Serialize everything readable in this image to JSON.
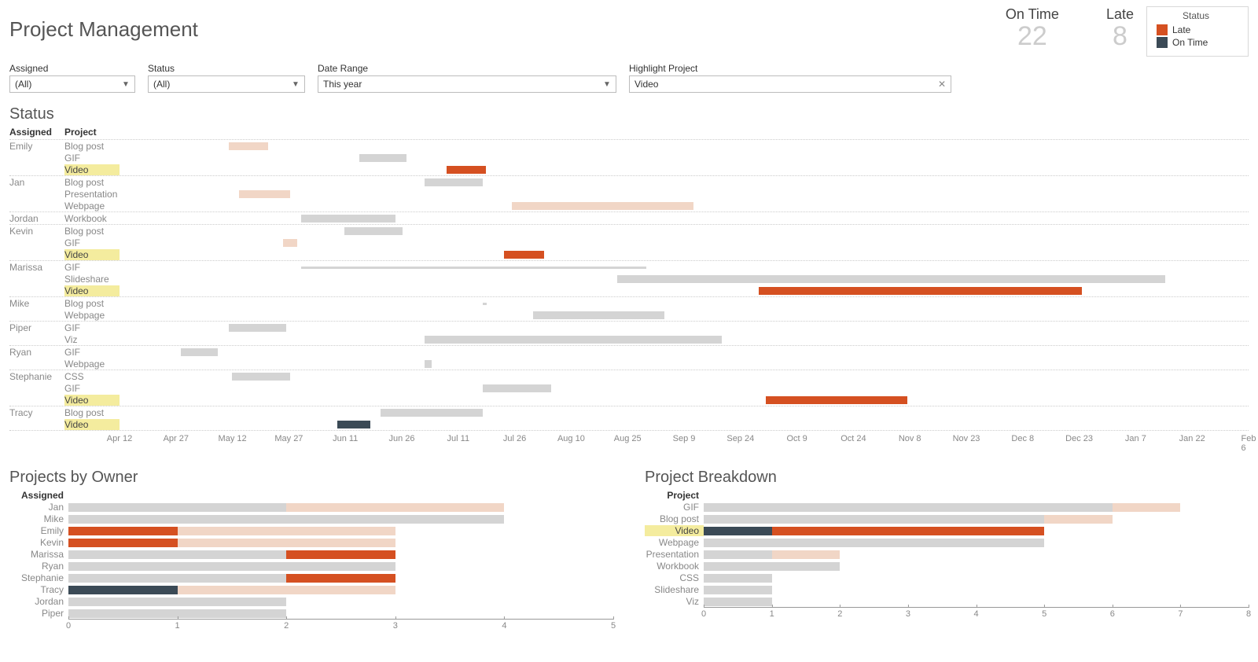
{
  "title": "Project Management",
  "kpis": {
    "ontime_label": "On Time",
    "ontime_value": "22",
    "late_label": "Late",
    "late_value": "8"
  },
  "legend": {
    "title": "Status",
    "late": "Late",
    "ontime": "On Time",
    "late_color": "#d55021",
    "ontime_color": "#3b4a56"
  },
  "filters": {
    "assigned": {
      "label": "Assigned",
      "value": "(All)"
    },
    "status": {
      "label": "Status",
      "value": "(All)"
    },
    "daterange": {
      "label": "Date Range",
      "value": "This year"
    },
    "highlight": {
      "label": "Highlight Project",
      "value": "Video"
    }
  },
  "colors": {
    "ontime": "#3b4a56",
    "late": "#d55021",
    "ontime_f": "#d4d4d4",
    "late_f": "#f1d6c6",
    "hl": "#f4ec9e"
  },
  "timeline": {
    "start": "2015-04-05",
    "end": "2016-02-10",
    "ticks": [
      "Apr 12",
      "Apr 27",
      "May 12",
      "May 27",
      "Jun 11",
      "Jun 26",
      "Jul 11",
      "Jul 26",
      "Aug 10",
      "Aug 25",
      "Sep 9",
      "Sep 24",
      "Oct 9",
      "Oct 24",
      "Nov 8",
      "Nov 23",
      "Dec 8",
      "Dec 23",
      "Jan 7",
      "Jan 22",
      "Feb 6"
    ]
  },
  "chart_data": {
    "gantt": {
      "type": "gantt",
      "xlabel": "",
      "ylabel": "",
      "groups": [
        {
          "assigned": "Emily",
          "rows": [
            {
              "project": "Blog post",
              "start": "2015-05-05",
              "end": "2015-05-16",
              "status": "late",
              "faded": true
            },
            {
              "project": "GIF",
              "start": "2015-06-10",
              "end": "2015-06-23",
              "status": "ontime",
              "faded": true
            },
            {
              "project": "Video",
              "start": "2015-07-04",
              "end": "2015-07-15",
              "status": "late",
              "faded": false,
              "highlight": true
            }
          ]
        },
        {
          "assigned": "Jan",
          "rows": [
            {
              "project": "Blog post",
              "start": "2015-06-28",
              "end": "2015-07-14",
              "status": "ontime",
              "faded": true
            },
            {
              "project": "Presentation",
              "start": "2015-05-08",
              "end": "2015-05-22",
              "status": "late",
              "faded": true
            },
            {
              "project": "Webpage",
              "start": "2015-07-22",
              "end": "2015-09-10",
              "status": "late",
              "faded": true
            }
          ]
        },
        {
          "assigned": "Jordan",
          "rows": [
            {
              "project": "Workbook",
              "start": "2015-05-25",
              "end": "2015-06-20",
              "status": "ontime",
              "faded": true
            }
          ]
        },
        {
          "assigned": "Kevin",
          "rows": [
            {
              "project": "Blog post",
              "start": "2015-06-06",
              "end": "2015-06-22",
              "status": "ontime",
              "faded": true
            },
            {
              "project": "GIF",
              "start": "2015-05-20",
              "end": "2015-05-24",
              "status": "late",
              "faded": true
            },
            {
              "project": "Video",
              "start": "2015-07-20",
              "end": "2015-07-31",
              "status": "late",
              "faded": false,
              "highlight": true
            }
          ]
        },
        {
          "assigned": "Marissa",
          "rows": [
            {
              "project": "GIF",
              "start": "2015-05-25",
              "end": "2015-08-28",
              "status": "ontime",
              "faded": true,
              "thin": true
            },
            {
              "project": "Slideshare",
              "start": "2015-08-20",
              "end": "2016-01-18",
              "status": "ontime",
              "faded": true
            },
            {
              "project": "Video",
              "start": "2015-09-28",
              "end": "2015-12-26",
              "status": "late",
              "faded": false,
              "highlight": true
            }
          ]
        },
        {
          "assigned": "Mike",
          "rows": [
            {
              "project": "Blog post",
              "start": "2015-07-14",
              "end": "2015-07-15",
              "status": "ontime",
              "faded": true,
              "thin": true
            },
            {
              "project": "Webpage",
              "start": "2015-07-28",
              "end": "2015-08-02",
              "status": "ontime",
              "faded": true
            },
            {
              "project": "Webpage",
              "start": "2015-07-31",
              "end": "2015-09-02",
              "status": "ontime",
              "faded": true,
              "same_row": true
            }
          ]
        },
        {
          "assigned": "Piper",
          "rows": [
            {
              "project": "GIF",
              "start": "2015-05-05",
              "end": "2015-05-21",
              "status": "ontime",
              "faded": true
            },
            {
              "project": "Viz",
              "start": "2015-06-28",
              "end": "2015-09-18",
              "status": "ontime",
              "faded": true
            }
          ]
        },
        {
          "assigned": "Ryan",
          "rows": [
            {
              "project": "GIF",
              "start": "2015-04-22",
              "end": "2015-05-02",
              "status": "ontime",
              "faded": true
            },
            {
              "project": "Webpage",
              "start": "2015-06-28",
              "end": "2015-06-30",
              "status": "ontime",
              "faded": true
            }
          ]
        },
        {
          "assigned": "Stephanie",
          "rows": [
            {
              "project": "CSS",
              "start": "2015-05-06",
              "end": "2015-05-22",
              "status": "ontime",
              "faded": true
            },
            {
              "project": "GIF",
              "start": "2015-07-14",
              "end": "2015-08-02",
              "status": "ontime",
              "faded": true
            },
            {
              "project": "Video",
              "start": "2015-09-30",
              "end": "2015-11-08",
              "status": "late",
              "faded": false,
              "highlight": true
            }
          ]
        },
        {
          "assigned": "Tracy",
          "rows": [
            {
              "project": "Blog post",
              "start": "2015-06-16",
              "end": "2015-07-14",
              "status": "ontime",
              "faded": true
            },
            {
              "project": "Video",
              "start": "2015-06-04",
              "end": "2015-06-13",
              "status": "ontime",
              "faded": false,
              "highlight": true
            }
          ]
        }
      ]
    },
    "owners": {
      "type": "bar",
      "title": "Projects by Owner",
      "category_label": "Assigned",
      "xlim": [
        0,
        5
      ],
      "categories": [
        "Jan",
        "Mike",
        "Emily",
        "Kevin",
        "Marissa",
        "Ryan",
        "Stephanie",
        "Tracy",
        "Jordan",
        "Piper"
      ],
      "series": [
        {
          "name": "On Time (faded)",
          "color": "ontime_f",
          "values": [
            2,
            4,
            0,
            0,
            2,
            3,
            2,
            0,
            2,
            2
          ]
        },
        {
          "name": "On Time",
          "color": "ontime",
          "values": [
            0,
            0,
            0,
            0,
            0,
            0,
            0,
            1,
            0,
            0
          ]
        },
        {
          "name": "Late",
          "color": "late",
          "values": [
            0,
            0,
            1,
            1,
            1,
            0,
            1,
            0,
            0,
            0
          ]
        },
        {
          "name": "Late (faded)",
          "color": "late_f",
          "values": [
            2,
            0,
            2,
            2,
            0,
            0,
            0,
            2,
            0,
            0
          ]
        }
      ]
    },
    "breakdown": {
      "type": "bar",
      "title": "Project Breakdown",
      "category_label": "Project",
      "xlim": [
        0,
        8
      ],
      "categories": [
        "GIF",
        "Blog post",
        "Video",
        "Webpage",
        "Presentation",
        "Workbook",
        "CSS",
        "Slideshare",
        "Viz"
      ],
      "series": [
        {
          "name": "On Time (faded)",
          "color": "ontime_f",
          "values": [
            6,
            5,
            0,
            5,
            1,
            2,
            1,
            1,
            1
          ]
        },
        {
          "name": "On Time",
          "color": "ontime",
          "values": [
            0,
            0,
            1,
            0,
            0,
            0,
            0,
            0,
            0
          ]
        },
        {
          "name": "Late",
          "color": "late",
          "values": [
            0,
            0,
            4,
            0,
            0,
            0,
            0,
            0,
            0
          ]
        },
        {
          "name": "Late (faded)",
          "color": "late_f",
          "values": [
            1,
            1,
            0,
            0,
            1,
            0,
            0,
            0,
            0
          ]
        }
      ],
      "highlight": [
        "Video"
      ]
    }
  },
  "section_titles": {
    "status": "Status",
    "owners": "Projects by Owner",
    "breakdown": "Project Breakdown"
  },
  "headers": {
    "assigned": "Assigned",
    "project": "Project"
  }
}
